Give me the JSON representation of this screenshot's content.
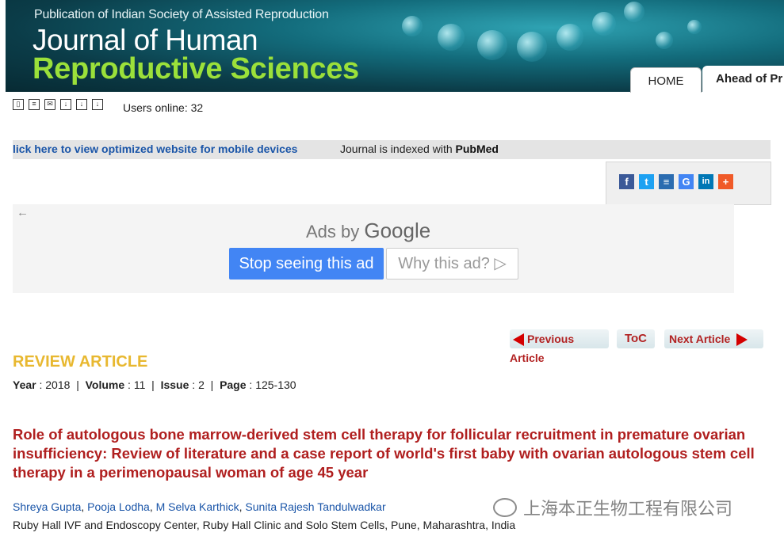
{
  "banner": {
    "publication": "Publication of Indian Society of Assisted Reproduction",
    "title_line1": "Journal of Human",
    "title_line2": "Reproductive Sciences",
    "tabs": [
      {
        "label": "HOME"
      },
      {
        "label": "Ahead of Pr"
      }
    ]
  },
  "toolbar": {
    "icons": [
      "book-icon",
      "print-icon",
      "email-icon",
      "pdf-icon",
      "pdf-icon",
      "pdf-icon"
    ],
    "users_online": "Users online: 32"
  },
  "infobar": {
    "mobile_link": "lick here to view optimized website for mobile devices",
    "indexed_prefix": "Journal is indexed with ",
    "indexed_name": "PubMed"
  },
  "share": {
    "icons": [
      {
        "name": "facebook-icon",
        "glyph": "f",
        "color": "#3b5998"
      },
      {
        "name": "twitter-icon",
        "glyph": "t",
        "color": "#1da1f2"
      },
      {
        "name": "lines-icon",
        "glyph": "≡",
        "color": "#2b6cb0"
      },
      {
        "name": "google-icon",
        "glyph": "G",
        "color": "#4285f4"
      },
      {
        "name": "linkedin-icon",
        "glyph": "in",
        "color": "#0077b5"
      },
      {
        "name": "plus-icon",
        "glyph": "+",
        "color": "#f05a28"
      }
    ]
  },
  "ads": {
    "ads_by": "Ads by ",
    "google": "Google",
    "stop_label": "Stop seeing this ad",
    "why_label": "Why this ad? ▷"
  },
  "nav": {
    "prev_label": "Previous Article",
    "toc_label": "ToC",
    "next_label": "Next Article"
  },
  "article": {
    "type": "REVIEW ARTICLE",
    "year_label": "Year",
    "year": "2018",
    "volume_label": "Volume",
    "volume": "11",
    "issue_label": "Issue",
    "issue": "2",
    "page_label": "Page",
    "page": "125-130",
    "title": "Role of autologous bone marrow-derived stem cell therapy for follicular recruitment in premature ovarian insufficiency: Review of literature and a case report of world's first baby with ovarian autologous stem cell therapy in a perimenopausal woman of age 45 year",
    "authors": [
      "Shreya Gupta",
      "Pooja Lodha",
      "M Selva Karthick",
      "Sunita Rajesh Tandulwadkar"
    ],
    "affiliation": "Ruby Hall IVF and Endoscopy Center, Ruby Hall Clinic and Solo Stem Cells, Pune, Maharashtra, India"
  },
  "watermark": {
    "text": "上海本正生物工程有限公司"
  }
}
